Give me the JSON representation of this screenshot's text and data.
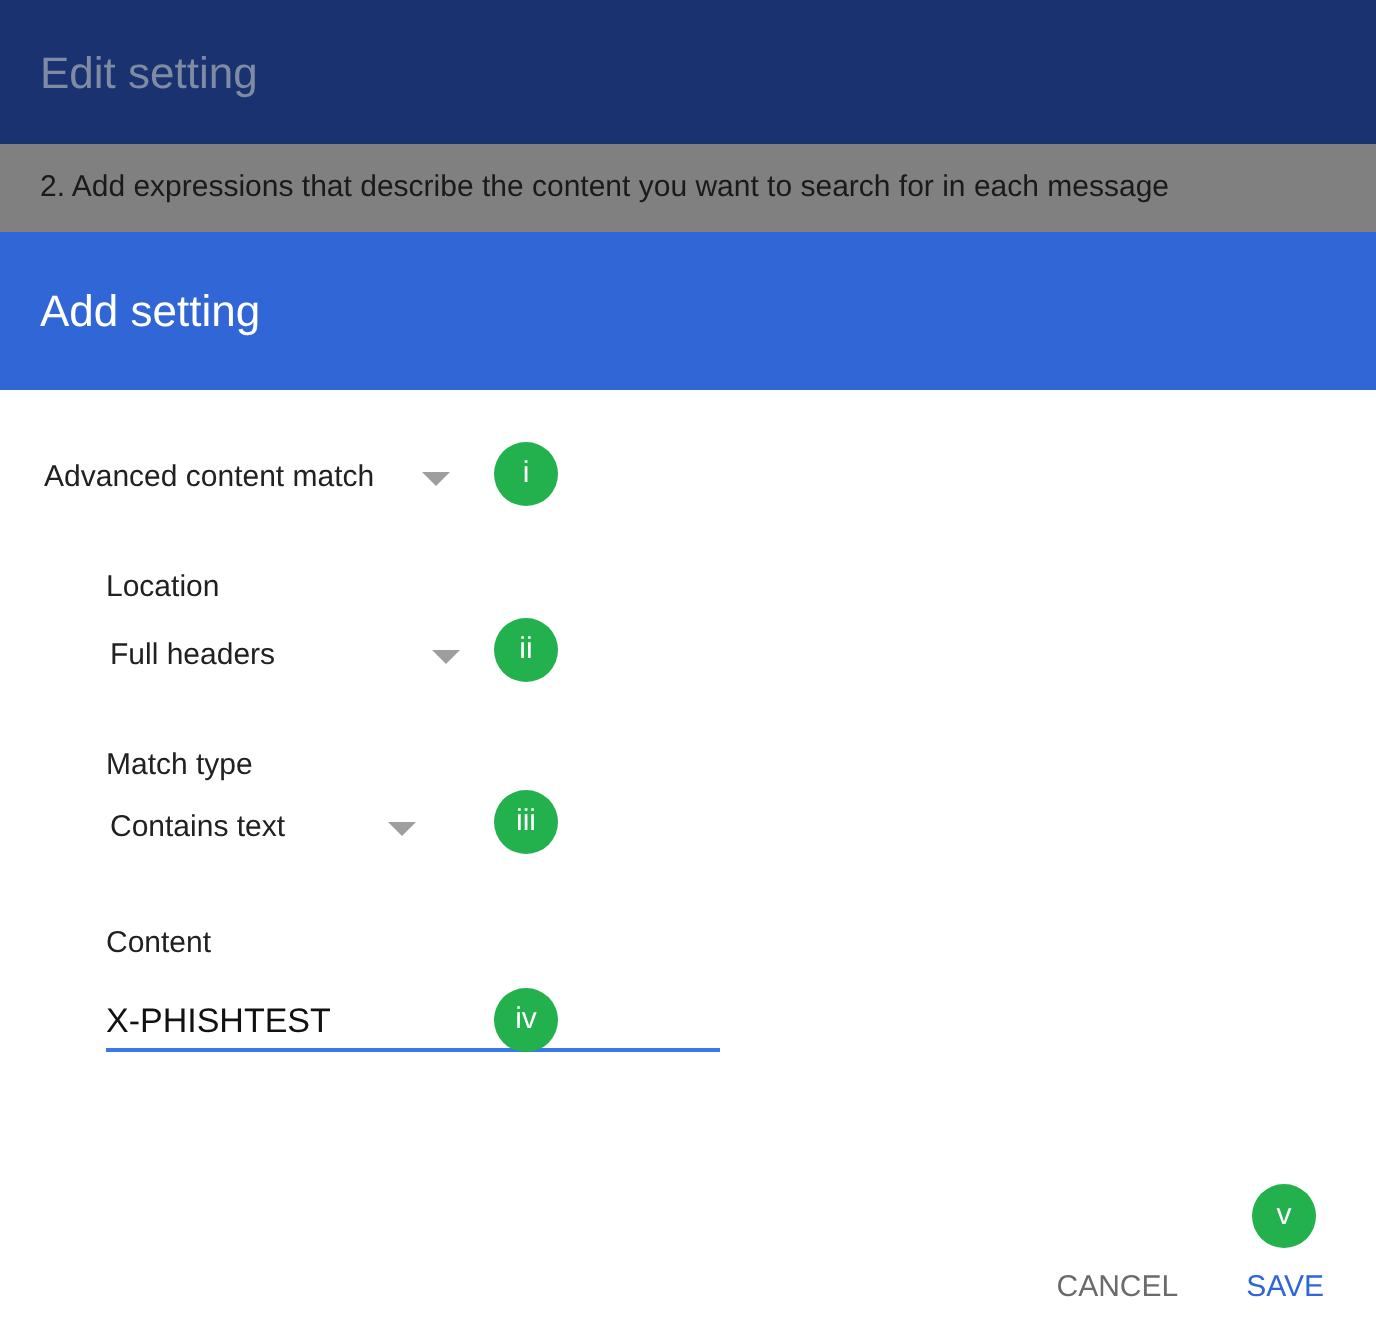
{
  "background": {
    "title": "Edit setting",
    "step": "2. Add expressions that describe the content you want to search for in each message"
  },
  "dialog": {
    "title": "Add setting",
    "condition": {
      "value": "Advanced content match",
      "badge": "i"
    },
    "fields": [
      {
        "kind": "select",
        "label": "Location",
        "value": "Full headers",
        "badge": "ii"
      },
      {
        "kind": "select",
        "label": "Match type",
        "value": "Contains text",
        "badge": "iii"
      },
      {
        "kind": "text",
        "label": "Content",
        "value": "X-PHISHTEST",
        "badge": "iv",
        "focused": true
      }
    ],
    "actions_badge": "v",
    "buttons": [
      {
        "label": "CANCEL",
        "primary": false
      },
      {
        "label": "SAVE",
        "primary": true
      }
    ]
  }
}
